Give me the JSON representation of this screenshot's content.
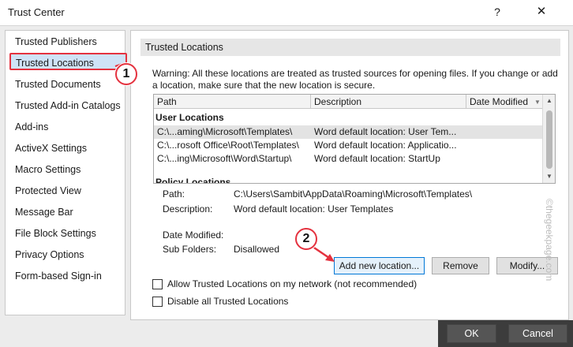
{
  "window": {
    "title": "Trust Center",
    "help": "?",
    "close": "✕"
  },
  "sidebar": {
    "items": [
      {
        "label": "Trusted Publishers"
      },
      {
        "label": "Trusted Locations"
      },
      {
        "label": "Trusted Documents"
      },
      {
        "label": "Trusted Add-in Catalogs"
      },
      {
        "label": "Add-ins"
      },
      {
        "label": "ActiveX Settings"
      },
      {
        "label": "Macro Settings"
      },
      {
        "label": "Protected View"
      },
      {
        "label": "Message Bar"
      },
      {
        "label": "File Block Settings"
      },
      {
        "label": "Privacy Options"
      },
      {
        "label": "Form-based Sign-in"
      }
    ]
  },
  "main": {
    "header": "Trusted Locations",
    "warning": "Warning: All these locations are treated as trusted sources for opening files.  If you change or add a location, make sure that the new location is secure.",
    "table": {
      "columns": [
        "Path",
        "Description",
        "Date Modified"
      ],
      "sort_glyph": "▼",
      "groups": [
        {
          "label": "User Locations",
          "rows": [
            {
              "path": "C:\\...aming\\Microsoft\\Templates\\",
              "description": "Word default location: User Tem...",
              "date": ""
            },
            {
              "path": "C:\\...rosoft Office\\Root\\Templates\\",
              "description": "Word default location: Applicatio...",
              "date": ""
            },
            {
              "path": "C:\\...ing\\Microsoft\\Word\\Startup\\",
              "description": "Word default location: StartUp",
              "date": ""
            }
          ]
        },
        {
          "label": "Policy Locations",
          "rows": []
        }
      ]
    },
    "details": {
      "path_label": "Path:",
      "path_value": "C:\\Users\\Sambit\\AppData\\Roaming\\Microsoft\\Templates\\",
      "description_label": "Description:",
      "description_value": "Word default location: User Templates",
      "date_label": "Date Modified:",
      "date_value": "",
      "subfolders_label": "Sub Folders:",
      "subfolders_value": "Disallowed"
    },
    "buttons": {
      "add": "Add new location...",
      "remove": "Remove",
      "modify": "Modify..."
    },
    "checkboxes": [
      {
        "label": "Allow Trusted Locations on my network (not recommended)",
        "checked": false
      },
      {
        "label": "Disable all Trusted Locations",
        "checked": false
      }
    ]
  },
  "footer": {
    "ok": "OK",
    "cancel": "Cancel"
  },
  "annotations": {
    "marker_1": "1",
    "marker_2": "2",
    "accent_color": "#e4323f"
  },
  "watermark": "©thegeekpage.com"
}
